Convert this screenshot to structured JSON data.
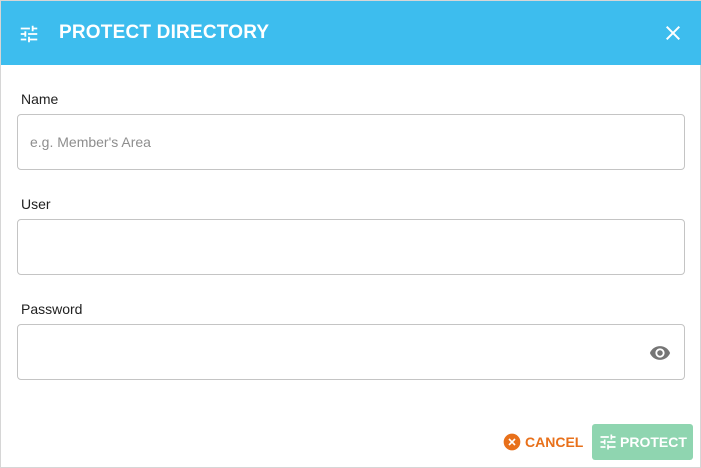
{
  "dialog": {
    "title": "PROTECT DIRECTORY",
    "header_icon": "tune-sliders-icon",
    "close_icon": "close-icon",
    "header_color": "#3dbdee"
  },
  "form": {
    "name": {
      "label": "Name",
      "value": "",
      "placeholder": "e.g. Member's Area"
    },
    "user": {
      "label": "User",
      "value": "",
      "placeholder": ""
    },
    "password": {
      "label": "Password",
      "value": "",
      "placeholder": "",
      "toggle_icon": "eye-icon"
    }
  },
  "actions": {
    "cancel_label": "CANCEL",
    "cancel_icon": "cancel-circle-icon",
    "cancel_color": "#e8701a",
    "protect_label": "PROTECT",
    "protect_icon": "tune-sliders-icon",
    "protect_color": "#8fd5b0"
  }
}
